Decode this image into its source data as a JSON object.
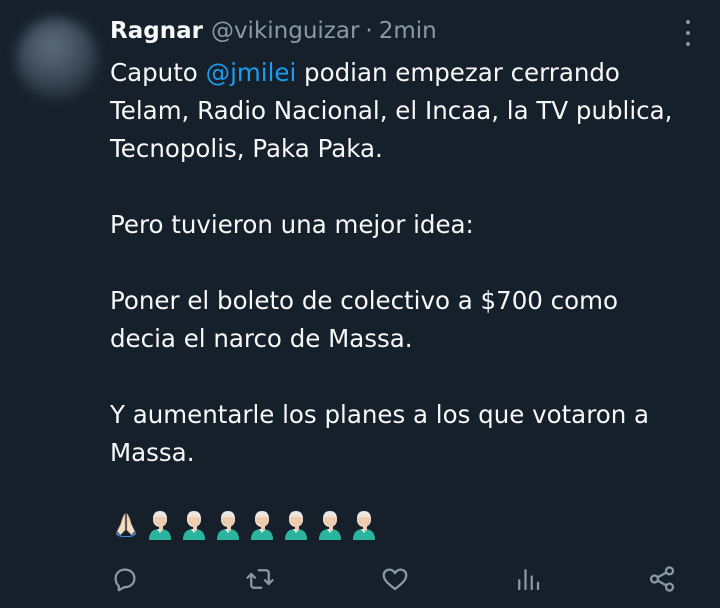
{
  "tweet": {
    "author_name": "Ragnar",
    "author_handle": "@vikinguizar",
    "separator": "·",
    "time": "2min",
    "lines": [
      {
        "pre": "Caputo ",
        "mention": "@jmilei",
        "post": " podian empezar cerrando"
      },
      {
        "text": "Telam, Radio Nacional, el Incaa, la TV publica,"
      },
      {
        "text": "Tecnopolis, Paka Paka."
      },
      {
        "text": ""
      },
      {
        "text": "Pero tuvieron una mejor idea:"
      },
      {
        "text": ""
      },
      {
        "text": "Poner el boleto de colectivo a $700 como"
      },
      {
        "text": "decia el narco de Massa."
      },
      {
        "text": ""
      },
      {
        "text": "Y aumentarle los planes a los que votaron a"
      },
      {
        "text": "Massa."
      }
    ],
    "emojis": [
      "folded-hands",
      "face-palm",
      "face-palm",
      "face-palm",
      "face-palm",
      "face-palm",
      "face-palm",
      "face-palm"
    ]
  },
  "actions": {
    "icons": [
      "reply-icon",
      "retweet-icon",
      "like-icon",
      "views-icon",
      "share-icon"
    ]
  },
  "colors": {
    "background": "#15202b",
    "text": "#f7f9f9",
    "muted": "#8b98a5",
    "link": "#1d9bf0"
  }
}
